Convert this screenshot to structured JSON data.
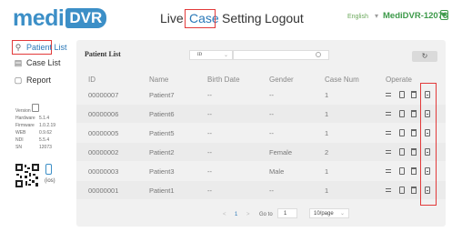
{
  "header": {
    "logo_text": "medi",
    "logo_badge": "DVR",
    "nav": [
      "Live",
      "Case",
      "Setting",
      "Logout"
    ],
    "active_nav": "Case",
    "language": "English",
    "device_name": "MediDVR-12073"
  },
  "sidebar": {
    "items": [
      {
        "label": "Patient List",
        "icon": "person-icon",
        "active": true
      },
      {
        "label": "Case List",
        "icon": "case-icon",
        "active": false
      },
      {
        "label": "Report",
        "icon": "report-icon",
        "active": false
      }
    ],
    "info": [
      {
        "key": "Version",
        "value": ""
      },
      {
        "key": "Hardware",
        "value": "5.1.4"
      },
      {
        "key": "Firmware",
        "value": "1.0.2.19"
      },
      {
        "key": "WEB",
        "value": "0.9.62"
      },
      {
        "key": "NDI",
        "value": "5.5.4"
      },
      {
        "key": "SN",
        "value": "12073"
      }
    ],
    "qr_label": "(ios)"
  },
  "patient_list": {
    "title": "Patient List",
    "search_field": "ID",
    "search_placeholder": "",
    "refresh_icon": "refresh-icon",
    "columns": [
      "ID",
      "Name",
      "Birth Date",
      "Gender",
      "Case Num",
      "Operate"
    ],
    "rows": [
      {
        "id": "00000007",
        "name": "Patient7",
        "birth": "--",
        "gender": "--",
        "cases": "1"
      },
      {
        "id": "00000006",
        "name": "Patient6",
        "birth": "--",
        "gender": "--",
        "cases": "1"
      },
      {
        "id": "00000005",
        "name": "Patient5",
        "birth": "--",
        "gender": "--",
        "cases": "1"
      },
      {
        "id": "00000002",
        "name": "Patient2",
        "birth": "--",
        "gender": "Female",
        "cases": "2"
      },
      {
        "id": "00000003",
        "name": "Patient3",
        "birth": "--",
        "gender": "Male",
        "cases": "1"
      },
      {
        "id": "00000001",
        "name": "Patient1",
        "birth": "--",
        "gender": "--",
        "cases": "1"
      }
    ],
    "operate_icons": [
      "settings-icon",
      "document-icon",
      "trash-icon",
      "report-icon"
    ]
  },
  "pagination": {
    "prev": "<",
    "current_page": "1",
    "next": ">",
    "goto_label": "Go to",
    "goto_value": "1",
    "page_size": "10/page"
  },
  "colors": {
    "brand": "#3c8fc7",
    "highlight_box": "#e23a3a",
    "device_green": "#3d9a4a"
  }
}
